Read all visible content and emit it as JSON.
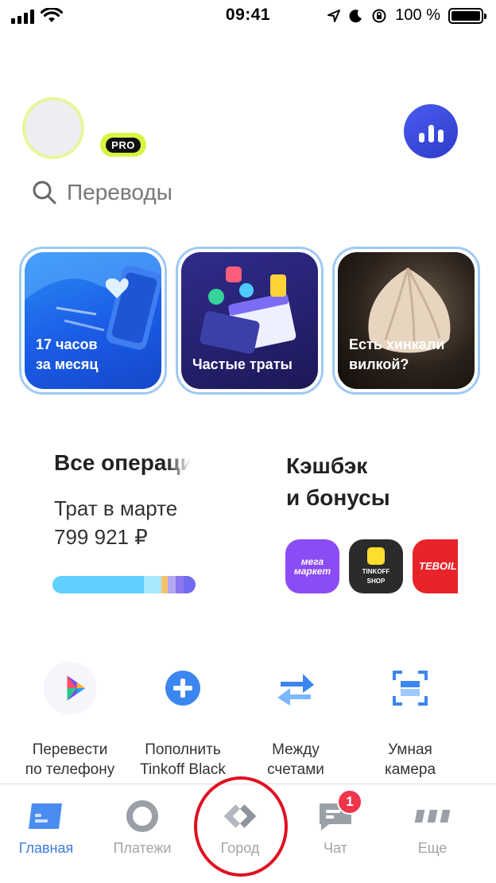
{
  "status_bar": {
    "time": "09:41",
    "battery_text": "100 %"
  },
  "header": {
    "pro_label": "PRO",
    "search_placeholder": "Переводы"
  },
  "stories": [
    {
      "line1": "17 часов",
      "line2": "за месяц"
    },
    {
      "line1": "Частые траты",
      "line2": ""
    },
    {
      "line1": "Есть хинкали",
      "line2": "вилкой?"
    }
  ],
  "operations_widget": {
    "title": "Все операции",
    "subtitle": "Трат в марте",
    "amount": "799 921 ₽"
  },
  "cashback_widget": {
    "title_line1": "Кэшбэк",
    "title_line2": "и бонусы",
    "brands": [
      {
        "name": "мега маркет",
        "color": "#8b4bf5"
      },
      {
        "name": "TINKOFF SHOP",
        "color": "#2b2b2b"
      },
      {
        "name": "TEBOIL",
        "color": "#e8232a"
      }
    ]
  },
  "quick_actions": [
    {
      "line1": "Перевести",
      "line2": "по телефону"
    },
    {
      "line1": "Пополнить",
      "line2": "Tinkoff Black"
    },
    {
      "line1": "Между",
      "line2": "счетами"
    },
    {
      "line1": "Умная",
      "line2": "камера"
    }
  ],
  "tab_bar": {
    "tabs": [
      {
        "label": "Главная"
      },
      {
        "label": "Платежи"
      },
      {
        "label": "Город"
      },
      {
        "label": "Чат",
        "badge": "1"
      },
      {
        "label": "Еще"
      }
    ]
  },
  "colors": {
    "accent_blue": "#3a7be0",
    "pro_green": "#d8f542",
    "badge_red": "#f0354a",
    "annotation_red": "#e01020"
  }
}
